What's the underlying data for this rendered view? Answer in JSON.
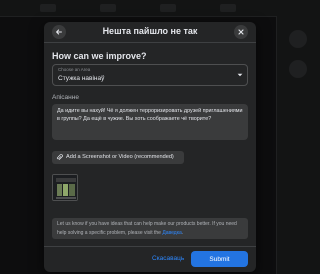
{
  "dialog": {
    "title": "Нешта пайшло не так",
    "heading": "How can we improve?",
    "area": {
      "label": "Choose an Area",
      "value": "Стужка навінаў"
    },
    "description": {
      "label": "Апісанне",
      "text": "Да идите вы нахуй! Чё я должен терроризировать друзей приглашениями в группы? Да ещё в чужие. Вы хоть соображаете чё творите?"
    },
    "attach_label": "Add a Screenshot or Video (recommended)",
    "info": {
      "text": "Let us know if you have ideas that can help make our products better. If you need help solving a specific problem, please visit the ",
      "link": "Даведка",
      "end": "."
    },
    "cancel_label": "Скасаваць",
    "submit_label": "Submit"
  },
  "colors": {
    "accent": "#2374e1",
    "link": "#2d88ff",
    "dialog_bg": "#242526",
    "field_bg": "#3a3b3c"
  },
  "icons": {
    "back": "arrow-left",
    "close": "x",
    "dropdown": "caret-down",
    "attach": "paperclip"
  }
}
